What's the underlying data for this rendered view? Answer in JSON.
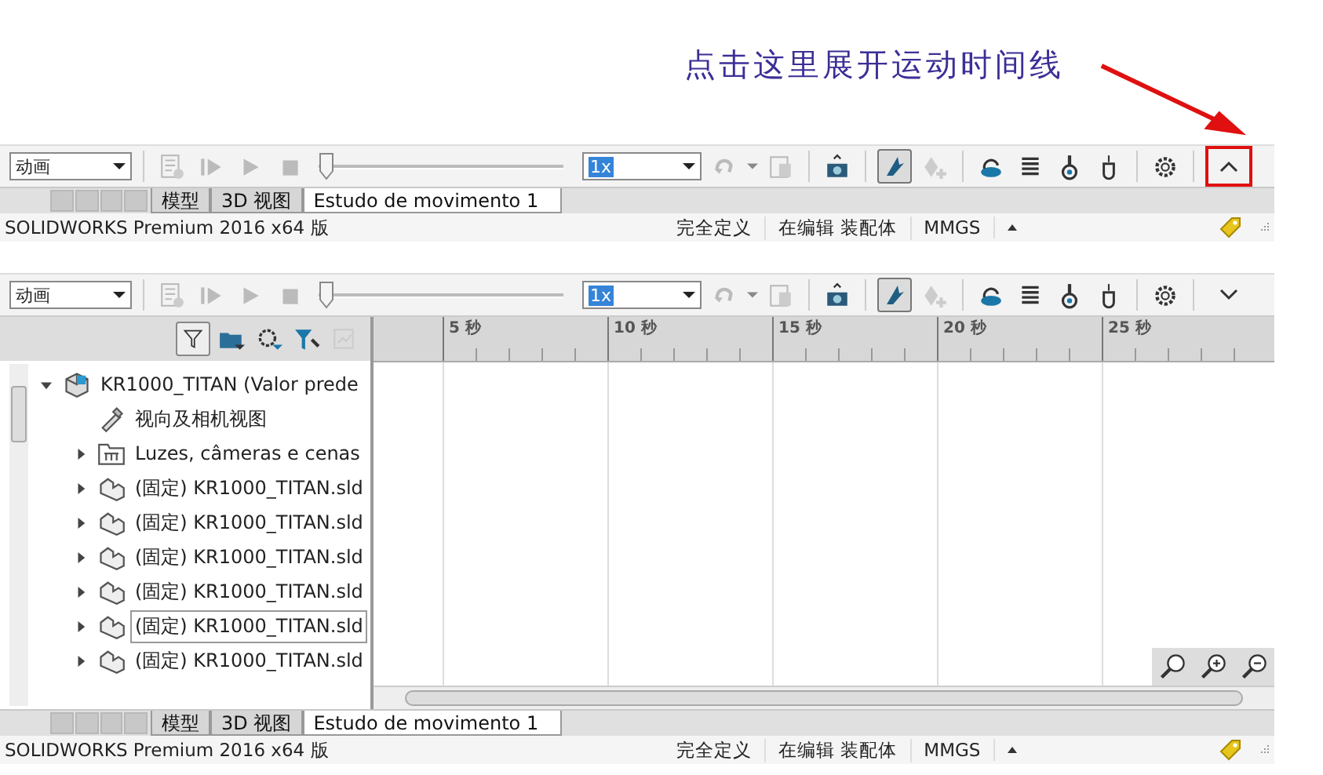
{
  "annotation": {
    "text": "点击这里展开运动时间线"
  },
  "panels": [
    {
      "toolbar": {
        "study_type": "动画",
        "time": {
          "level": 0
        },
        "speed": "1x",
        "autokey": true,
        "timeline_expanded": false,
        "highlighted": true
      },
      "tabs": [
        {
          "label": "模型",
          "selected": false
        },
        {
          "label": "3D 视图",
          "selected": false
        },
        {
          "label": "Estudo de movimento 1",
          "selected": true
        }
      ],
      "status": {
        "product": "SOLIDWORKS Premium 2016 x64 版",
        "state": "完全定义",
        "mode": "在编辑 装配体",
        "units": "MMGS"
      }
    },
    {
      "toolbar": {
        "study_type": "动画",
        "time": {
          "level": 0
        },
        "speed": "1x",
        "autokey": true,
        "timeline_expanded": true,
        "highlighted": false
      },
      "ruler": [
        "5 秒",
        "10 秒",
        "15 秒",
        "20 秒",
        "25 秒"
      ],
      "tree": [
        {
          "label": "KR1000_TITAN  (Valor prede",
          "kind": "assembly",
          "expanded": true,
          "selected": false,
          "children": [
            {
              "label": "视向及相机视图",
              "kind": "camera",
              "selected": false
            },
            {
              "label": "Luzes, câmeras e cenas",
              "kind": "folder",
              "expanded": false,
              "selected": false
            },
            {
              "label": "(固定) KR1000_TITAN.sld",
              "kind": "part",
              "expanded": false,
              "selected": false
            },
            {
              "label": "(固定) KR1000_TITAN.sld",
              "kind": "part",
              "expanded": false,
              "selected": false
            },
            {
              "label": "(固定) KR1000_TITAN.sld",
              "kind": "part",
              "expanded": false,
              "selected": false
            },
            {
              "label": "(固定) KR1000_TITAN.sld",
              "kind": "part",
              "expanded": false,
              "selected": false
            },
            {
              "label": "(固定) KR1000_TITAN.sld",
              "kind": "part",
              "expanded": false,
              "selected": true
            },
            {
              "label": "(固定) KR1000_TITAN.sld",
              "kind": "part",
              "expanded": false,
              "selected": false
            }
          ]
        }
      ],
      "tabs": [
        {
          "label": "模型",
          "selected": false
        },
        {
          "label": "3D 视图",
          "selected": false
        },
        {
          "label": "Estudo de movimento 1",
          "selected": true
        }
      ],
      "status": {
        "product": "SOLIDWORKS Premium 2016 x64 版",
        "state": "完全定义",
        "mode": "在编辑 装配体",
        "units": "MMGS"
      }
    }
  ]
}
